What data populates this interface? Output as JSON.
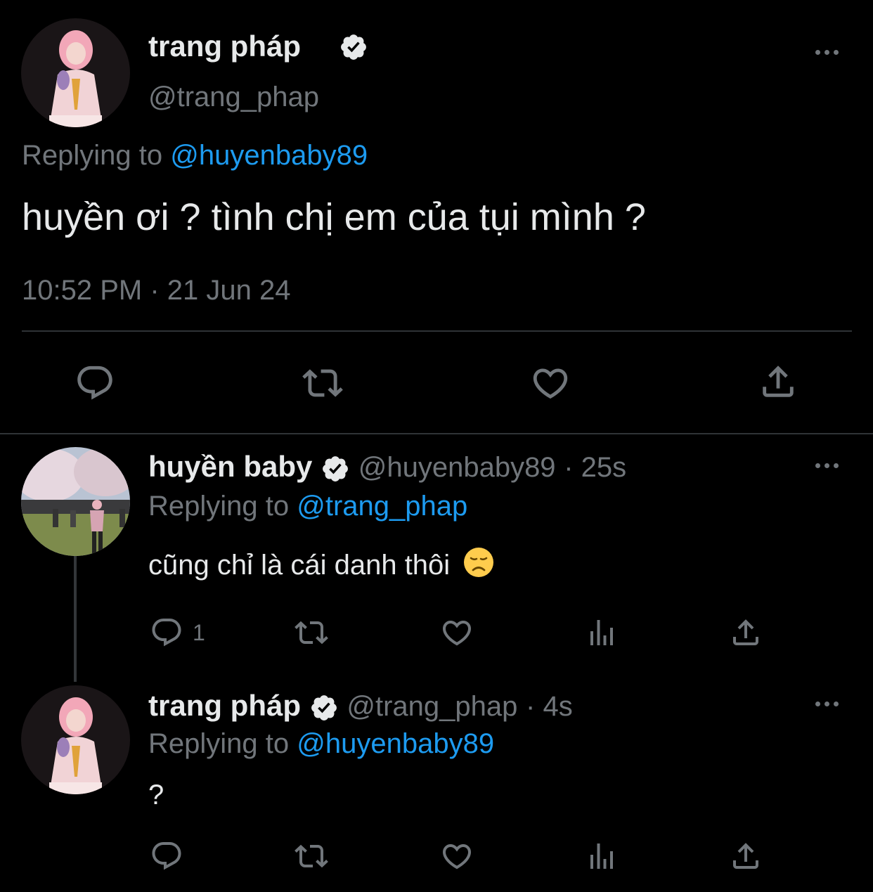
{
  "main_tweet": {
    "author_name": "trang pháp",
    "author_handle": "@trang_phap",
    "replying_prefix": "Replying to",
    "replying_to": "@huyenbaby89",
    "text": "huyền ơi ? tình chị em của tụi mình ?",
    "timestamp": "10:52 PM · 21 Jun 24"
  },
  "reply_1": {
    "author_name": "huyền baby",
    "author_handle": "@huyenbaby89",
    "age": "· 25s",
    "replying_prefix": "Replying to",
    "replying_to": "@trang_phap",
    "text": "cũng chỉ là cái danh thôi",
    "emoji": "😞",
    "reply_count": "1"
  },
  "reply_2": {
    "author_name": "trang pháp",
    "author_handle": "@trang_phap",
    "age": "· 4s",
    "replying_prefix": "Replying to",
    "replying_to": "@huyenbaby89",
    "text": "?"
  },
  "colors": {
    "background": "#000000",
    "text": "#e7e9ea",
    "secondary": "#71767b",
    "link": "#1d9bf0",
    "divider": "#2f3336"
  },
  "icons": [
    "verified-badge-icon",
    "more-icon",
    "reply-icon",
    "retweet-icon",
    "like-icon",
    "views-icon",
    "share-icon"
  ]
}
